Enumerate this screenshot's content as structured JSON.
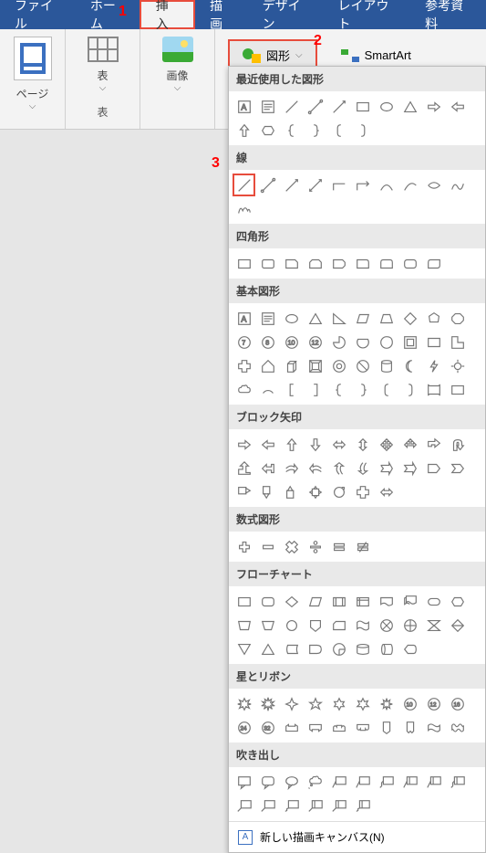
{
  "menu": {
    "tabs": [
      "ファイル",
      "ホーム",
      "挿入",
      "描画",
      "デザイン",
      "レイアウト",
      "参考資料"
    ],
    "active_index": 2
  },
  "annotations": {
    "a1": "1",
    "a2": "2",
    "a3": "3"
  },
  "ribbon": {
    "page": "ページ",
    "table": "表",
    "table_group": "表",
    "image": "画像",
    "shapes": "図形",
    "smartart": "SmartArt"
  },
  "shapes_dropdown": {
    "sections": {
      "recent": "最近使用した図形",
      "lines": "線",
      "rects": "四角形",
      "basic": "基本図形",
      "arrows": "ブロック矢印",
      "equation": "数式図形",
      "flowchart": "フローチャート",
      "stars": "星とリボン",
      "callouts": "吹き出し"
    },
    "footer": "新しい描画キャンバス(N)"
  }
}
